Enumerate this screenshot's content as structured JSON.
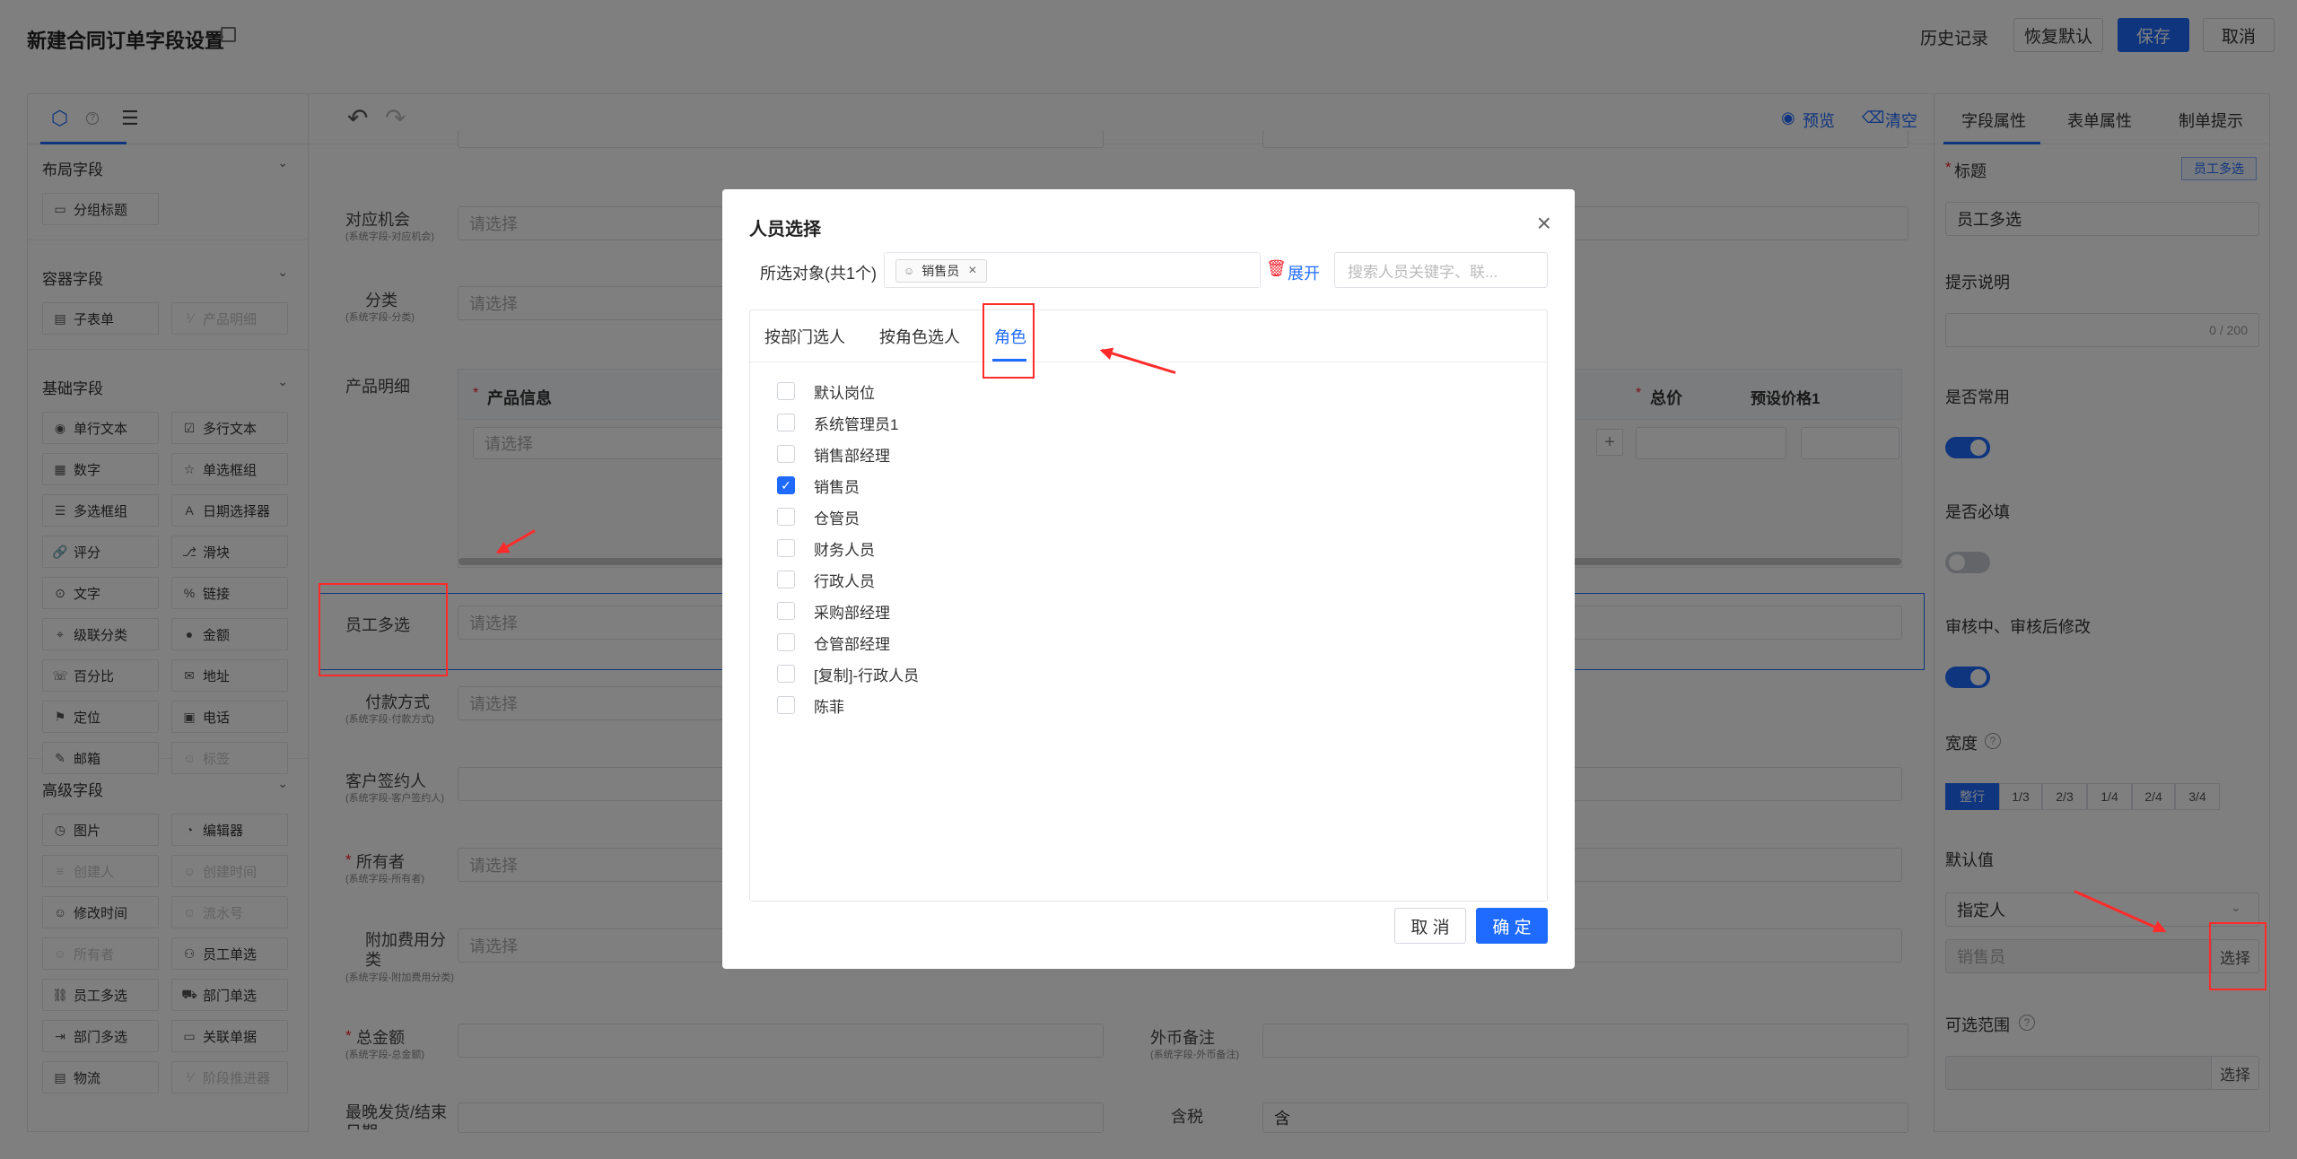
{
  "header": {
    "title": "新建合同订单字段设置",
    "history": "历史记录",
    "restore": "恢复默认",
    "save": "保存",
    "cancel": "取消"
  },
  "toolbar": {
    "preview": "预览",
    "clear": "清空"
  },
  "left_panel": {
    "sections": [
      {
        "title": "布局字段",
        "items": [
          {
            "label": "分组标题",
            "icon": "group-icon",
            "disabled": false
          }
        ]
      },
      {
        "title": "容器字段",
        "items": [
          {
            "label": "子表单",
            "icon": "table-icon",
            "disabled": false
          },
          {
            "label": "产品明细",
            "icon": "table-icon",
            "disabled": true
          }
        ]
      },
      {
        "title": "基础字段",
        "items": [
          {
            "label": "单行文本",
            "disabled": false
          },
          {
            "label": "多行文本",
            "disabled": false
          },
          {
            "label": "数字",
            "disabled": false
          },
          {
            "label": "单选框组",
            "disabled": false
          },
          {
            "label": "多选框组",
            "disabled": false
          },
          {
            "label": "日期选择器",
            "disabled": false
          },
          {
            "label": "评分",
            "disabled": false
          },
          {
            "label": "滑块",
            "disabled": false
          },
          {
            "label": "文字",
            "disabled": false
          },
          {
            "label": "链接",
            "disabled": false
          },
          {
            "label": "级联分类",
            "disabled": false
          },
          {
            "label": "金额",
            "disabled": false
          },
          {
            "label": "百分比",
            "disabled": false
          },
          {
            "label": "地址",
            "disabled": false
          },
          {
            "label": "定位",
            "disabled": false
          },
          {
            "label": "电话",
            "disabled": false
          },
          {
            "label": "邮箱",
            "disabled": false
          },
          {
            "label": "标签",
            "disabled": true
          }
        ]
      },
      {
        "title": "高级字段",
        "items": [
          {
            "label": "图片",
            "disabled": false
          },
          {
            "label": "编辑器",
            "disabled": false
          },
          {
            "label": "创建人",
            "disabled": true
          },
          {
            "label": "创建时间",
            "disabled": true
          },
          {
            "label": "修改时间",
            "disabled": false
          },
          {
            "label": "流水号",
            "disabled": true
          },
          {
            "label": "所有者",
            "disabled": true
          },
          {
            "label": "员工单选",
            "disabled": false
          },
          {
            "label": "员工多选",
            "disabled": false
          },
          {
            "label": "部门单选",
            "disabled": false
          },
          {
            "label": "部门多选",
            "disabled": false
          },
          {
            "label": "关联单据",
            "disabled": false
          },
          {
            "label": "物流",
            "disabled": false
          },
          {
            "label": "阶段推进器",
            "disabled": true
          }
        ]
      }
    ]
  },
  "form": {
    "placeholder": "请选择",
    "rows": {
      "opportunity": {
        "label": "对应机会",
        "sub": "(系统字段-对应机会)"
      },
      "category": {
        "label": "分类",
        "sub": "(系统字段-分类)"
      },
      "product_detail": {
        "label": "产品明细",
        "col_product": "产品信息",
        "col_total": "总价",
        "col_preset": "预设价格1"
      },
      "employee_multi": {
        "label": "员工多选"
      },
      "payment": {
        "label": "付款方式",
        "sub": "(系统字段-付款方式)"
      },
      "signer": {
        "label": "客户签约人",
        "sub": "(系统字段-客户签约人)"
      },
      "owner": {
        "label": "所有者",
        "sub": "(系统字段-所有者)"
      },
      "extra_fee": {
        "label": "附加费用分类",
        "sub": "(系统字段-附加费用分类)"
      },
      "total": {
        "label": "总金额",
        "sub": "(系统字段-总金额)"
      },
      "fx_note": {
        "label": "外币备注",
        "sub": "(系统字段-外币备注)"
      },
      "latest_ship": {
        "label": "最晚发货/结束日期"
      },
      "tax": {
        "label": "含税",
        "value": "含"
      }
    }
  },
  "right_panel": {
    "tabs": [
      "字段属性",
      "表单属性",
      "制单提示"
    ],
    "badge": "员工多选",
    "title_label": "标题",
    "title_value": "员工多选",
    "hint_label": "提示说明",
    "hint_count": "0 / 200",
    "common_label": "是否常用",
    "common_on": true,
    "required_label": "是否必填",
    "required_on": false,
    "audit_label": "审核中、审核后修改",
    "audit_on": true,
    "width_label": "宽度",
    "width_options": [
      "整行",
      "1/3",
      "2/3",
      "1/4",
      "2/4",
      "3/4"
    ],
    "default_label": "默认值",
    "default_type": "指定人",
    "default_value": "销售员",
    "select_btn": "选择",
    "range_label": "可选范围",
    "range_select_btn": "选择"
  },
  "modal": {
    "title": "人员选择",
    "selected_label": "所选对象(共1个)",
    "selected_tag": "销售员",
    "expand": "展开",
    "search_placeholder": "搜索人员关键字、联...",
    "tabs": [
      "按部门选人",
      "按角色选人",
      "角色"
    ],
    "active_tab": 2,
    "roles": [
      {
        "name": "默认岗位",
        "checked": false
      },
      {
        "name": "系统管理员1",
        "checked": false
      },
      {
        "name": "销售部经理",
        "checked": false
      },
      {
        "name": "销售员",
        "checked": true
      },
      {
        "name": "仓管员",
        "checked": false
      },
      {
        "name": "财务人员",
        "checked": false
      },
      {
        "name": "行政人员",
        "checked": false
      },
      {
        "name": "采购部经理",
        "checked": false
      },
      {
        "name": "仓管部经理",
        "checked": false
      },
      {
        "name": "[复制]-行政人员",
        "checked": false
      },
      {
        "name": "陈菲",
        "checked": false
      }
    ],
    "cancel": "取 消",
    "confirm": "确 定"
  },
  "colors": {
    "primary": "#1f6bff",
    "annotation": "#ff2a2a"
  }
}
